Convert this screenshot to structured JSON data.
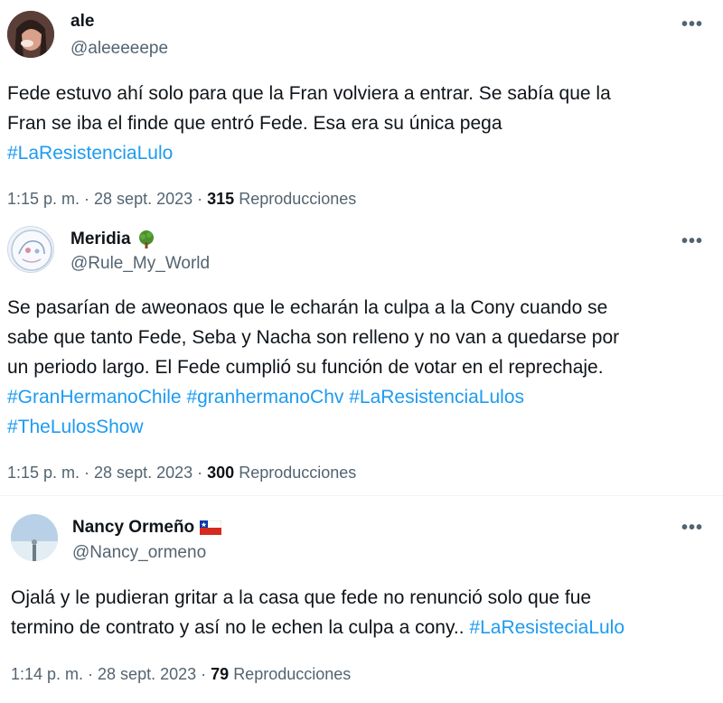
{
  "tweets": [
    {
      "name": "ale",
      "handle": "@aleeeeepe",
      "more": "•••",
      "lines": [
        "Fede estuvo ahí solo para que la Fran volviera a entrar. Se sabía que la",
        "Fran se iba el finde que entró Fede. Esa era su única pega"
      ],
      "hashtags_line": [
        "#LaResistenciaLulo"
      ],
      "time": "1:15 p. m. · 28 sept. 2023 ·",
      "views_count": "315",
      "views_label": "Reproducciones"
    },
    {
      "name": "Meridia",
      "name_emoji_icon": "tree-icon",
      "handle": "@Rule_My_World",
      "more": "•••",
      "lines": [
        "Se pasarían de aweonaos que le echarán la culpa a la Cony cuando se",
        "sabe que tanto Fede, Seba y Nacha son relleno y no van a quedarse por",
        "un periodo largo. El Fede cumplió su función de votar en el reprechaje."
      ],
      "hashtags_line": [
        "#GranHermanoChile",
        "#granhermanoChv",
        "#LaResistenciaLulos"
      ],
      "hashtags_line2": [
        "#TheLulosShow"
      ],
      "time": "1:15 p. m. · 28 sept. 2023 ·",
      "views_count": "300",
      "views_label": "Reproducciones"
    },
    {
      "name": "Nancy Ormeño",
      "name_emoji_icon": "chile-flag-icon",
      "handle": "@Nancy_ormeno",
      "more": "•••",
      "lines": [
        "Ojalá y le pudieran gritar a la casa que fede no renunció solo que fue",
        "termino de contrato y así no le echen la culpa a cony.."
      ],
      "inline_hashtag": "#LaResisteciaLulo",
      "time": "1:14 p. m. · 28 sept. 2023 ·",
      "views_count": "79",
      "views_label": "Reproducciones"
    }
  ]
}
